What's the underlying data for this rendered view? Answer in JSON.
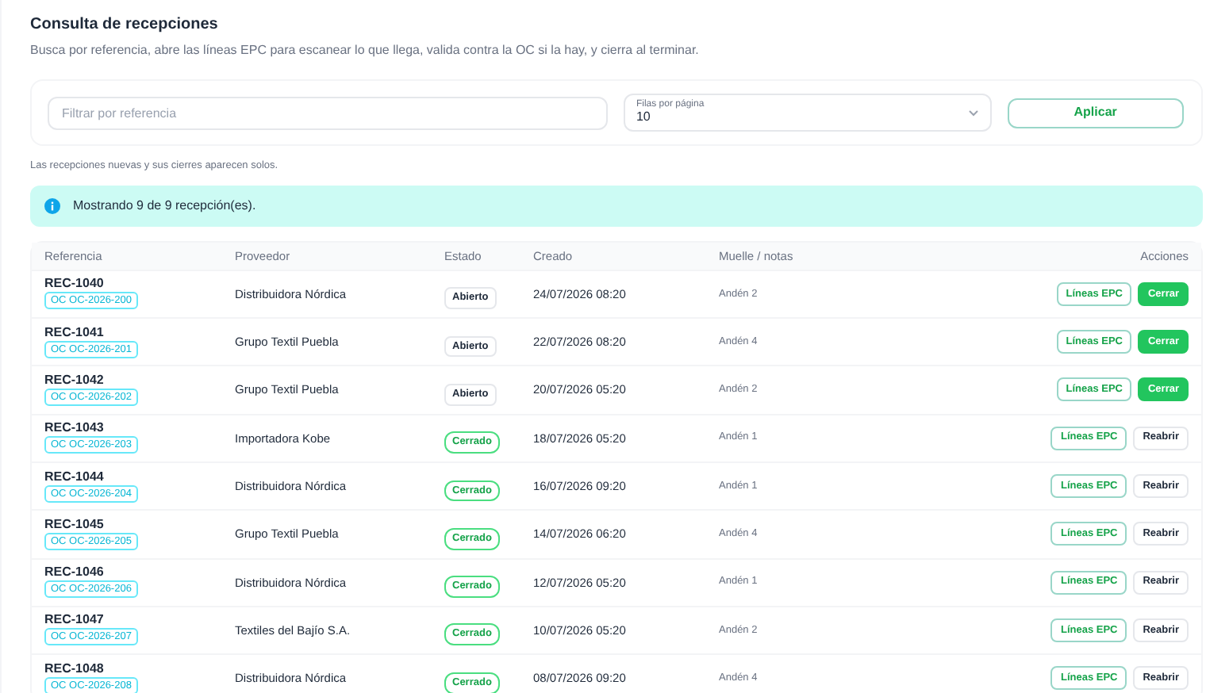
{
  "header": {
    "title": "Consulta de recepciones",
    "description": "Busca por referencia, abre las líneas EPC para escanear lo que llega, valida contra la OC si la hay, y cierra al terminar."
  },
  "filters": {
    "search": {
      "placeholder": "Filtrar por referencia"
    },
    "page_size": {
      "label": "Filas por página",
      "value": "10"
    },
    "apply_button": "Aplicar"
  },
  "live_note": "Las recepciones nuevas y sus cierres aparecen solos.",
  "alert": {
    "text": "Mostrando 9 de 9 recepción(es)."
  },
  "table": {
    "columns": [
      "Referencia",
      "Proveedor",
      "Estado",
      "Creado",
      "Muelle / notas",
      "Acciones"
    ],
    "rows": [
      {
        "reference": "REC-1040",
        "order": "OC OC-2026-200",
        "supplier": "Distribuidora Nórdica",
        "status": {
          "kind": "open",
          "label": "Abierto"
        },
        "created": "24/07/2026 08:20",
        "notes": "Andén 2",
        "actions": [
          "Líneas EPC",
          "Cerrar"
        ]
      },
      {
        "reference": "REC-1041",
        "order": "OC OC-2026-201",
        "supplier": "Grupo Textil Puebla",
        "status": {
          "kind": "open",
          "label": "Abierto"
        },
        "created": "22/07/2026 08:20",
        "notes": "Andén 4",
        "actions": [
          "Líneas EPC",
          "Cerrar"
        ]
      },
      {
        "reference": "REC-1042",
        "order": "OC OC-2026-202",
        "supplier": "Grupo Textil Puebla",
        "status": {
          "kind": "open",
          "label": "Abierto"
        },
        "created": "20/07/2026 05:20",
        "notes": "Andén 2",
        "actions": [
          "Líneas EPC",
          "Cerrar"
        ]
      },
      {
        "reference": "REC-1043",
        "order": "OC OC-2026-203",
        "supplier": "Importadora Kobe",
        "status": {
          "kind": "closed",
          "label": "Cerrado"
        },
        "created": "18/07/2026 05:20",
        "notes": "Andén 1",
        "actions": [
          "Líneas EPC",
          "Reabrir"
        ]
      },
      {
        "reference": "REC-1044",
        "order": "OC OC-2026-204",
        "supplier": "Distribuidora Nórdica",
        "status": {
          "kind": "closed",
          "label": "Cerrado"
        },
        "created": "16/07/2026 09:20",
        "notes": "Andén 1",
        "actions": [
          "Líneas EPC",
          "Reabrir"
        ]
      },
      {
        "reference": "REC-1045",
        "order": "OC OC-2026-205",
        "supplier": "Grupo Textil Puebla",
        "status": {
          "kind": "closed",
          "label": "Cerrado"
        },
        "created": "14/07/2026 06:20",
        "notes": "Andén 4",
        "actions": [
          "Líneas EPC",
          "Reabrir"
        ]
      },
      {
        "reference": "REC-1046",
        "order": "OC OC-2026-206",
        "supplier": "Distribuidora Nórdica",
        "status": {
          "kind": "closed",
          "label": "Cerrado"
        },
        "created": "12/07/2026 05:20",
        "notes": "Andén 1",
        "actions": [
          "Líneas EPC",
          "Reabrir"
        ]
      },
      {
        "reference": "REC-1047",
        "order": "OC OC-2026-207",
        "supplier": "Textiles del Bajío S.A.",
        "status": {
          "kind": "closed",
          "label": "Cerrado"
        },
        "created": "10/07/2026 05:20",
        "notes": "Andén 2",
        "actions": [
          "Líneas EPC",
          "Reabrir"
        ]
      },
      {
        "reference": "REC-1048",
        "order": "OC OC-2026-208",
        "supplier": "Distribuidora Nórdica",
        "status": {
          "kind": "closed",
          "label": "Cerrado"
        },
        "created": "08/07/2026 09:20",
        "notes": "Andén 4",
        "actions": [
          "Líneas EPC",
          "Reabrir"
        ]
      }
    ]
  }
}
